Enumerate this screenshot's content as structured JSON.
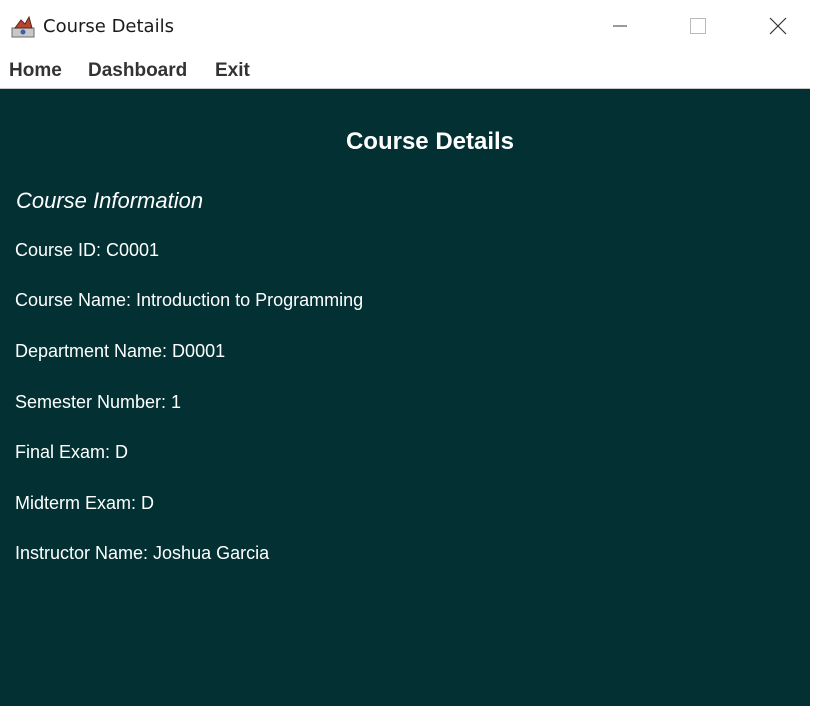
{
  "window": {
    "title": "Course Details",
    "controls": [
      "minimize-icon",
      "maximize-icon",
      "close-icon"
    ]
  },
  "menu": {
    "items": [
      "Home",
      "Dashboard",
      "Exit"
    ]
  },
  "main": {
    "heading": "Course Details",
    "section_title": "Course Information",
    "fields": [
      "Course ID: C0001",
      "Course Name: Introduction to Programming",
      "Department Name: D0001",
      "Semester Number: 1",
      "Final Exam: D",
      "Midterm Exam: D",
      "Instructor Name: Joshua Garcia"
    ]
  },
  "colors": {
    "content_background": "#033133",
    "text": "#ffffff",
    "menu_text": "#333333"
  }
}
